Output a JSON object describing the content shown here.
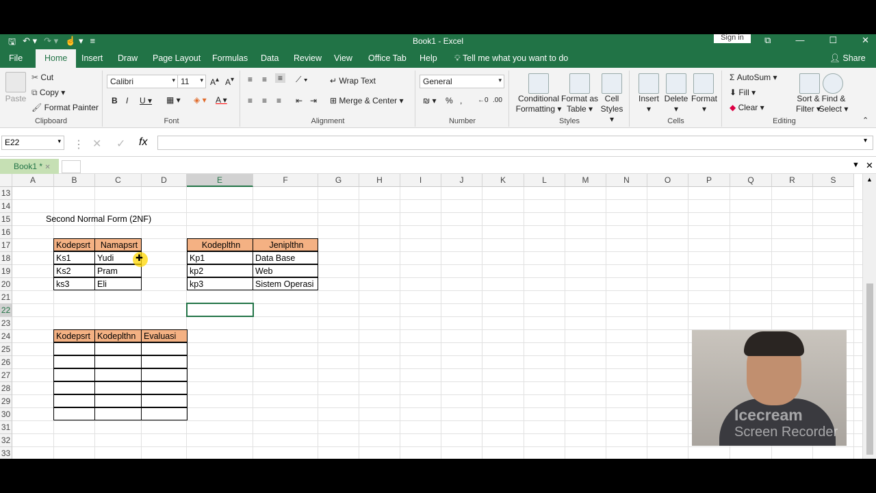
{
  "window": {
    "title": "Book1 - Excel",
    "signin_label": "Sign in"
  },
  "tabs": [
    "File",
    "Home",
    "Insert",
    "Draw",
    "Page Layout",
    "Formulas",
    "Data",
    "Review",
    "View",
    "Office Tab",
    "Help"
  ],
  "active_tab": "Home",
  "tell_me": "Tell me what you want to do",
  "share_label": "Share",
  "ribbon": {
    "clipboard": {
      "paste": "Paste",
      "cut": "Cut",
      "copy": "Copy",
      "format_painter": "Format Painter",
      "label": "Clipboard"
    },
    "font": {
      "name": "Calibri",
      "size": "11",
      "label": "Font"
    },
    "alignment": {
      "wrap_text": "Wrap Text",
      "merge_center": "Merge & Center",
      "label": "Alignment"
    },
    "number": {
      "format": "General",
      "label": "Number"
    },
    "styles": {
      "conditional": "Conditional",
      "conditional2": "Formatting",
      "format_as": "Format as",
      "format_as2": "Table",
      "cell": "Cell",
      "cell2": "Styles",
      "label": "Styles"
    },
    "cells": {
      "insert": "Insert",
      "delete": "Delete",
      "format": "Format",
      "label": "Cells"
    },
    "editing": {
      "autosum": "AutoSum",
      "fill": "Fill",
      "clear": "Clear",
      "sort": "Sort &",
      "sort2": "Filter",
      "find": "Find &",
      "find2": "Select",
      "label": "Editing"
    }
  },
  "formula_bar": {
    "name_box": "E22",
    "formula": ""
  },
  "workbook_tab": "Book1 *",
  "columns": [
    "A",
    "B",
    "C",
    "D",
    "E",
    "F",
    "G",
    "H",
    "I",
    "J",
    "K",
    "L",
    "M",
    "N",
    "O",
    "P",
    "Q",
    "R",
    "S"
  ],
  "rows": [
    "13",
    "14",
    "15",
    "16",
    "17",
    "18",
    "19",
    "20",
    "21",
    "22",
    "23",
    "24",
    "25",
    "26",
    "27",
    "28",
    "29",
    "30",
    "31",
    "32",
    "33"
  ],
  "sheet": {
    "heading": "Second Normal Form (2NF)",
    "table1": {
      "headers": [
        "Kodepsrt",
        "Namapsrt"
      ],
      "rows": [
        [
          "Ks1",
          "Yudi"
        ],
        [
          "Ks2",
          "Pram"
        ],
        [
          "ks3",
          "Eli"
        ]
      ]
    },
    "table2": {
      "headers": [
        "Kodeplthn",
        "Jeniplthn"
      ],
      "rows": [
        [
          "Kp1",
          "Data Base"
        ],
        [
          "kp2",
          "Web"
        ],
        [
          "kp3",
          "Sistem Operasi"
        ]
      ]
    },
    "table3": {
      "headers": [
        "Kodepsrt",
        "Kodeplthn",
        "Evaluasi"
      ]
    }
  },
  "colors": {
    "excel_green": "#217346",
    "header_fill": "#f4b183"
  }
}
